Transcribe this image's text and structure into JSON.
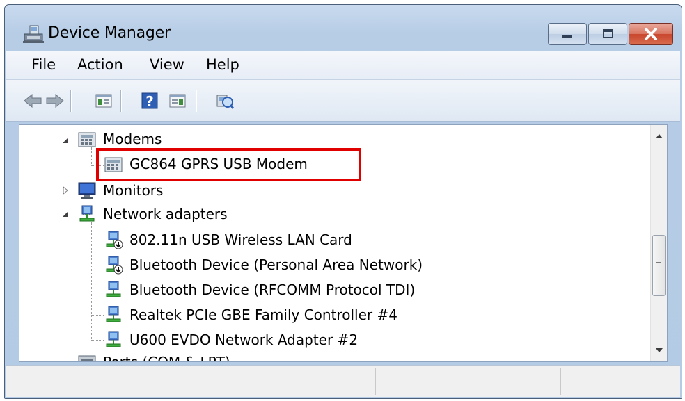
{
  "window": {
    "title": "Device Manager"
  },
  "menu": {
    "items": [
      {
        "label": "File"
      },
      {
        "label": "Action"
      },
      {
        "label": "View"
      },
      {
        "label": "Help"
      }
    ]
  },
  "toolbar": {
    "buttons": [
      "back-arrow-icon",
      "forward-arrow-icon",
      "show-hide-console-tree-icon",
      "help-icon",
      "properties-icon",
      "scan-hardware-changes-icon"
    ]
  },
  "tree": {
    "categories": [
      {
        "label": "Modems",
        "expanded": true,
        "children": [
          "GC864 GPRS USB Modem"
        ]
      },
      {
        "label": "Monitors",
        "expanded": false,
        "children": []
      },
      {
        "label": "Network adapters",
        "expanded": true,
        "children": [
          "802.11n USB Wireless LAN Card",
          "Bluetooth Device (Personal Area Network)",
          "Bluetooth Device (RFCOMM Protocol TDI)",
          "Realtek PCIe GBE Family Controller #4",
          "U600 EVDO Network Adapter #2"
        ]
      }
    ],
    "partial_next": "Ports (COM & LPT)"
  },
  "highlight_color": "#e00000"
}
